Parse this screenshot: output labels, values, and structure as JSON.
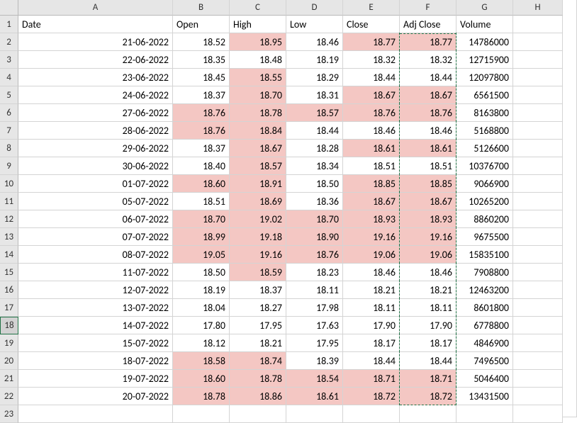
{
  "columns": [
    "",
    "A",
    "B",
    "C",
    "D",
    "E",
    "F",
    "G",
    "H"
  ],
  "headers": {
    "A": "Date",
    "B": "Open",
    "C": "High",
    "D": "Low",
    "E": "Close",
    "F": "Adj Close",
    "G": "Volume"
  },
  "rows": [
    {
      "n": "2",
      "A": "21-06-2022",
      "B": "18.52",
      "C": "18.95",
      "D": "18.46",
      "E": "18.77",
      "F": "18.77",
      "G": "14786000",
      "hl": {
        "C": true,
        "E": true,
        "F": true
      }
    },
    {
      "n": "3",
      "A": "22-06-2022",
      "B": "18.35",
      "C": "18.48",
      "D": "18.19",
      "E": "18.32",
      "F": "18.32",
      "G": "12715900",
      "hl": {}
    },
    {
      "n": "4",
      "A": "23-06-2022",
      "B": "18.45",
      "C": "18.55",
      "D": "18.29",
      "E": "18.44",
      "F": "18.44",
      "G": "12097800",
      "hl": {
        "C": true
      }
    },
    {
      "n": "5",
      "A": "24-06-2022",
      "B": "18.37",
      "C": "18.70",
      "D": "18.31",
      "E": "18.67",
      "F": "18.67",
      "G": "6561500",
      "hl": {
        "C": true,
        "E": true,
        "F": true
      }
    },
    {
      "n": "6",
      "A": "27-06-2022",
      "B": "18.76",
      "C": "18.78",
      "D": "18.57",
      "E": "18.76",
      "F": "18.76",
      "G": "8163800",
      "hl": {
        "B": true,
        "C": true,
        "D": true,
        "E": true,
        "F": true
      }
    },
    {
      "n": "7",
      "A": "28-06-2022",
      "B": "18.76",
      "C": "18.84",
      "D": "18.44",
      "E": "18.46",
      "F": "18.46",
      "G": "5168800",
      "hl": {
        "B": true,
        "C": true
      }
    },
    {
      "n": "8",
      "A": "29-06-2022",
      "B": "18.37",
      "C": "18.67",
      "D": "18.28",
      "E": "18.61",
      "F": "18.61",
      "G": "5126600",
      "hl": {
        "C": true,
        "E": true,
        "F": true
      }
    },
    {
      "n": "9",
      "A": "30-06-2022",
      "B": "18.40",
      "C": "18.57",
      "D": "18.34",
      "E": "18.51",
      "F": "18.51",
      "G": "10376700",
      "hl": {
        "C": true
      }
    },
    {
      "n": "10",
      "A": "01-07-2022",
      "B": "18.60",
      "C": "18.91",
      "D": "18.50",
      "E": "18.85",
      "F": "18.85",
      "G": "9066900",
      "hl": {
        "B": true,
        "C": true,
        "E": true,
        "F": true
      }
    },
    {
      "n": "11",
      "A": "05-07-2022",
      "B": "18.51",
      "C": "18.69",
      "D": "18.36",
      "E": "18.67",
      "F": "18.67",
      "G": "10265200",
      "hl": {
        "C": true,
        "E": true,
        "F": true
      }
    },
    {
      "n": "12",
      "A": "06-07-2022",
      "B": "18.70",
      "C": "19.02",
      "D": "18.70",
      "E": "18.93",
      "F": "18.93",
      "G": "8860200",
      "hl": {
        "B": true,
        "C": true,
        "D": true,
        "E": true,
        "F": true
      }
    },
    {
      "n": "13",
      "A": "07-07-2022",
      "B": "18.99",
      "C": "19.18",
      "D": "18.90",
      "E": "19.16",
      "F": "19.16",
      "G": "9675500",
      "hl": {
        "B": true,
        "C": true,
        "D": true,
        "E": true,
        "F": true
      }
    },
    {
      "n": "14",
      "A": "08-07-2022",
      "B": "19.05",
      "C": "19.16",
      "D": "18.76",
      "E": "19.06",
      "F": "19.06",
      "G": "15835100",
      "hl": {
        "B": true,
        "C": true,
        "D": true,
        "E": true,
        "F": true
      }
    },
    {
      "n": "15",
      "A": "11-07-2022",
      "B": "18.50",
      "C": "18.59",
      "D": "18.23",
      "E": "18.46",
      "F": "18.46",
      "G": "7908800",
      "hl": {
        "C": true
      }
    },
    {
      "n": "16",
      "A": "12-07-2022",
      "B": "18.19",
      "C": "18.37",
      "D": "18.11",
      "E": "18.21",
      "F": "18.21",
      "G": "12463200",
      "hl": {}
    },
    {
      "n": "17",
      "A": "13-07-2022",
      "B": "18.04",
      "C": "18.27",
      "D": "17.98",
      "E": "18.11",
      "F": "18.11",
      "G": "8601800",
      "hl": {}
    },
    {
      "n": "18",
      "A": "14-07-2022",
      "B": "17.80",
      "C": "17.95",
      "D": "17.63",
      "E": "17.90",
      "F": "17.90",
      "G": "6778800",
      "hl": {}
    },
    {
      "n": "19",
      "A": "15-07-2022",
      "B": "18.12",
      "C": "18.21",
      "D": "17.95",
      "E": "18.17",
      "F": "18.17",
      "G": "4846900",
      "hl": {}
    },
    {
      "n": "20",
      "A": "18-07-2022",
      "B": "18.58",
      "C": "18.74",
      "D": "18.39",
      "E": "18.44",
      "F": "18.44",
      "G": "7496500",
      "hl": {
        "B": true,
        "C": true
      }
    },
    {
      "n": "21",
      "A": "19-07-2022",
      "B": "18.60",
      "C": "18.78",
      "D": "18.54",
      "E": "18.71",
      "F": "18.71",
      "G": "5046400",
      "hl": {
        "B": true,
        "C": true,
        "D": true,
        "E": true,
        "F": true
      }
    },
    {
      "n": "22",
      "A": "20-07-2022",
      "B": "18.78",
      "C": "18.86",
      "D": "18.61",
      "E": "18.72",
      "F": "18.72",
      "G": "13431500",
      "hl": {
        "B": true,
        "C": true,
        "D": true,
        "E": true,
        "F": true
      }
    }
  ],
  "selected_row": "18"
}
